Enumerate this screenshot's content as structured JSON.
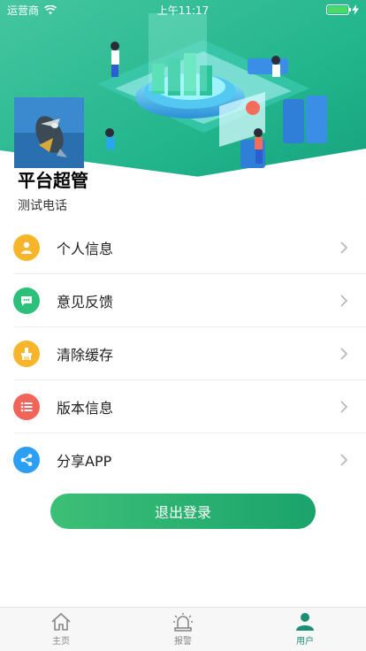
{
  "status_bar": {
    "carrier": "运营商",
    "time": "上午11:17",
    "battery_level": 1.0
  },
  "profile": {
    "name": "平台超管",
    "phone_label": "测试电话"
  },
  "menu": [
    {
      "label": "个人信息",
      "icon": "user-icon",
      "color": "#f7b52c"
    },
    {
      "label": "意见反馈",
      "icon": "message-icon",
      "color": "#2cc07a"
    },
    {
      "label": "清除缓存",
      "icon": "broom-icon",
      "color": "#f7b52c"
    },
    {
      "label": "版本信息",
      "icon": "list-icon",
      "color": "#f2645a"
    },
    {
      "label": "分享APP",
      "icon": "share-icon",
      "color": "#2c9ff2"
    }
  ],
  "logout_label": "退出登录",
  "tabs": [
    {
      "label": "主页",
      "icon": "home-icon",
      "active": false
    },
    {
      "label": "报警",
      "icon": "alarm-icon",
      "active": false
    },
    {
      "label": "用户",
      "icon": "user-icon",
      "active": true
    }
  ],
  "colors": {
    "accent": "#1aa36b",
    "tab_active": "#1a8f75"
  }
}
